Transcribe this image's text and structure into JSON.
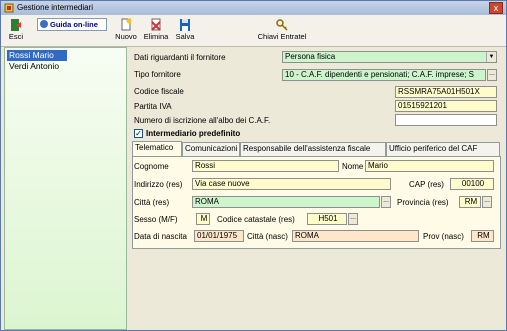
{
  "window": {
    "title": "Gestione intermediari",
    "close_glyph": "x"
  },
  "toolbar": {
    "esci": "Esci",
    "guida": "Guida on-line",
    "nuovo": "Nuovo",
    "elimina": "Elimina",
    "salva": "Salva",
    "chiavi": "Chiavi Entratel"
  },
  "list": {
    "items": [
      "Rossi Mario",
      "Verdi Antonio"
    ],
    "selected_index": 0
  },
  "form": {
    "dati_label": "Dati riguardanti il fornitore",
    "dati_value": "Persona fisica",
    "tipo_label": "Tipo fornitore",
    "tipo_value": "10 - C.A.F. dipendenti e pensionati; C.A.F. imprese; S",
    "cf_label": "Codice fiscale",
    "cf_value": "RSSMRA75A01H501X",
    "piva_label": "Partita IVA",
    "piva_value": "01515921201",
    "albo_label": "Numero di iscrizione all'albo dei C.A.F.",
    "albo_value": "",
    "predefinito_label": "Intermediario predefinito",
    "predefinito_checked": true
  },
  "tabs": [
    "Telematico",
    "Comunicazioni",
    "Responsabile dell'assistenza fiscale",
    "Ufficio periferico del CAF"
  ],
  "active_tab": 0,
  "anagrafica": {
    "cognome_label": "Cognome",
    "cognome": "Rossi",
    "nome_label": "Nome",
    "nome": "Mario",
    "indirizzo_label": "Indirizzo (res)",
    "indirizzo": "Via case nuove",
    "cap_label": "CAP (res)",
    "cap": "00100",
    "citta_label": "Città (res)",
    "citta": "ROMA",
    "provincia_label": "Provincia (res)",
    "provincia": "RM",
    "sesso_label": "Sesso (M/F)",
    "sesso": "M",
    "codcat_label": "Codice catastale (res)",
    "codcat": "H501",
    "nascita_label": "Data di nascita",
    "nascita": "01/01/1975",
    "citta_nasc_label": "Città (nasc)",
    "citta_nasc": "ROMA",
    "prov_nasc_label": "Prov (nasc)",
    "prov_nasc": "RM"
  },
  "icons": {
    "app": "app-icon",
    "esci": "exit-door-icon",
    "guida": "help-globe-icon",
    "nuovo": "new-document-icon",
    "elimina": "delete-icon",
    "salva": "floppy-disk-icon",
    "chiavi": "keys-icon",
    "ellipsis_glyph": "...",
    "dropdown_glyph": "▼",
    "check_glyph": "✓"
  },
  "colors": {
    "selected": "#316ac5",
    "field_yellow": "#fffccc",
    "field_green": "#ccf5cc",
    "field_peach": "#fde6c9"
  }
}
